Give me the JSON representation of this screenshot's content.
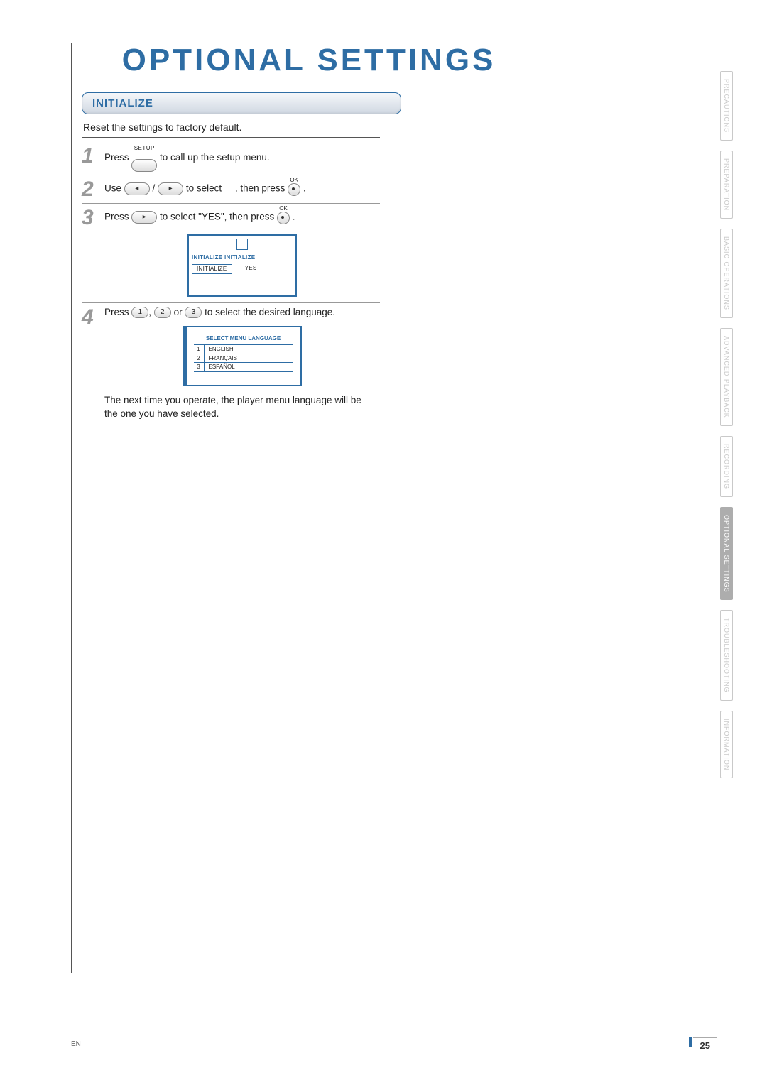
{
  "title": "OPTIONAL SETTINGS",
  "section": "INITIALIZE",
  "intro": "Reset the settings to factory default.",
  "steps": {
    "s1": {
      "num": "1",
      "pre": "Press",
      "btn_label": "SETUP",
      "post": "to call up the setup menu."
    },
    "s2": {
      "num": "2",
      "t_use": "Use",
      "t_sep": "/",
      "t_select": "to select",
      "t_then": ", then press",
      "ok_label": "OK",
      "period": "."
    },
    "s3": {
      "num": "3",
      "t_press": "Press",
      "t_select_yes": "to select \"YES\", then press",
      "ok_label": "OK",
      "period": ".",
      "osd": {
        "head": "INITIALIZE   INITIALIZE",
        "left": "INITIALIZE",
        "right": "YES"
      }
    },
    "s4": {
      "num": "4",
      "t_press": "Press",
      "n1": "1",
      "n2": "2",
      "n3": "3",
      "comma": ",",
      "or": "or",
      "t_lang": "to select the desired language.",
      "osd": {
        "title": "SELECT MENU LANGUAGE",
        "rows": [
          {
            "n": "1",
            "name": "ENGLISH"
          },
          {
            "n": "2",
            "name": "FRANÇAIS"
          },
          {
            "n": "3",
            "name": "ESPAÑOL"
          }
        ]
      },
      "note": "The next time you operate, the player menu language will be the one you have selected."
    }
  },
  "tabs": [
    {
      "label": "PRECAUTIONS",
      "active": false
    },
    {
      "label": "PREPARATION",
      "active": false
    },
    {
      "label": "BASIC   OPERATIONS",
      "active": false
    },
    {
      "label": "ADVANCED   PLAYBACK",
      "active": false
    },
    {
      "label": "RECORDING",
      "active": false
    },
    {
      "label": "OPTIONAL   SETTINGS",
      "active": true
    },
    {
      "label": "TROUBLESHOOTING",
      "active": false
    },
    {
      "label": "INFORMATION",
      "active": false
    }
  ],
  "footer": {
    "lang": "EN",
    "page": "25"
  }
}
